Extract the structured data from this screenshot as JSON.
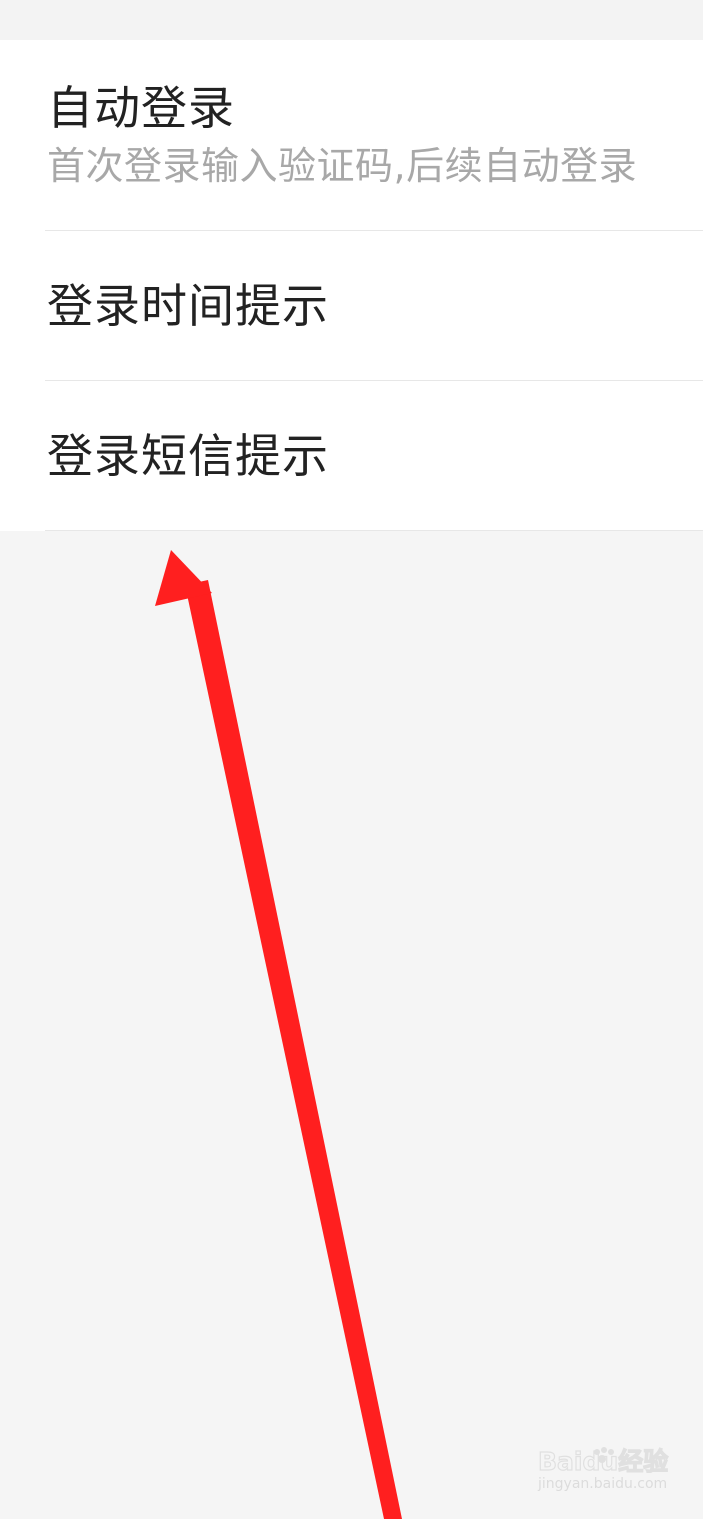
{
  "settings": {
    "items": [
      {
        "title": "自动登录",
        "subtitle": "首次登录输入验证码,后续自动登录"
      },
      {
        "title": "登录时间提示"
      },
      {
        "title": "登录短信提示"
      }
    ]
  },
  "annotation": {
    "arrow_color": "#ff1f1f"
  },
  "watermark": {
    "logo": "Baidu经验",
    "domain": "jingyan.baidu.com"
  },
  "colors": {
    "background": "#f5f5f5",
    "card": "#ffffff",
    "title_text": "#222222",
    "subtitle_text": "#a8a8a8",
    "divider": "#e7e7e7"
  }
}
